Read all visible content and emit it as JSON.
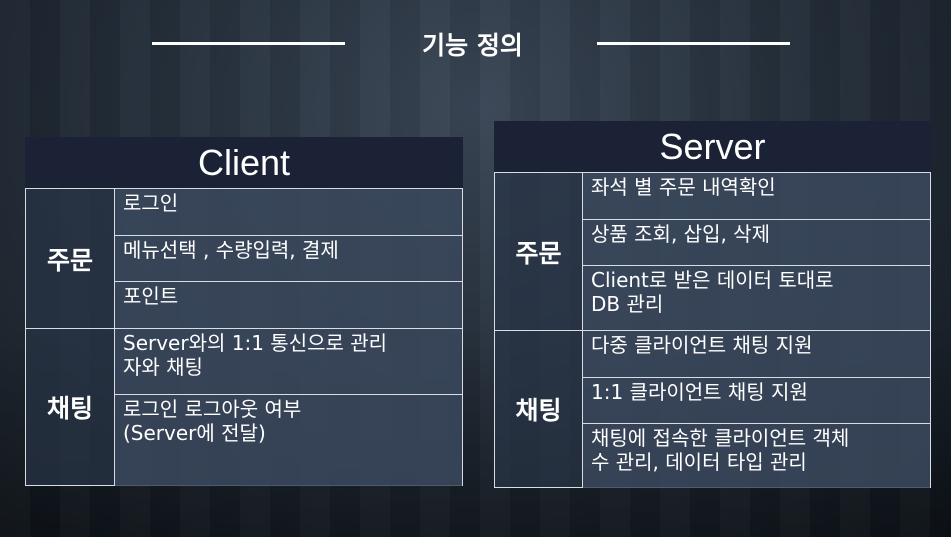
{
  "title": "기능 정의",
  "client": {
    "header": "Client",
    "sections": [
      {
        "category": "주문",
        "items": [
          "로그인",
          "메뉴선택 , 수량입력, 결제",
          "포인트"
        ]
      },
      {
        "category": "채팅",
        "items": [
          "Server와의 1:1 통신으로 관리\n자와 채팅",
          "로그인 로그아웃 여부\n(Server에 전달)"
        ]
      }
    ]
  },
  "server": {
    "header": "Server",
    "sections": [
      {
        "category": "주문",
        "items": [
          "좌석 별 주문 내역확인",
          "상품 조회, 삽입, 삭제",
          "Client로 받은 데이터 토대로\nDB 관리"
        ]
      },
      {
        "category": "채팅",
        "items": [
          "다중 클라이언트 채팅 지원",
          "1:1 클라이언트 채팅 지원",
          "채팅에 접속한 클라이언트 객체\n수 관리, 데이터 타입 관리"
        ]
      }
    ]
  }
}
